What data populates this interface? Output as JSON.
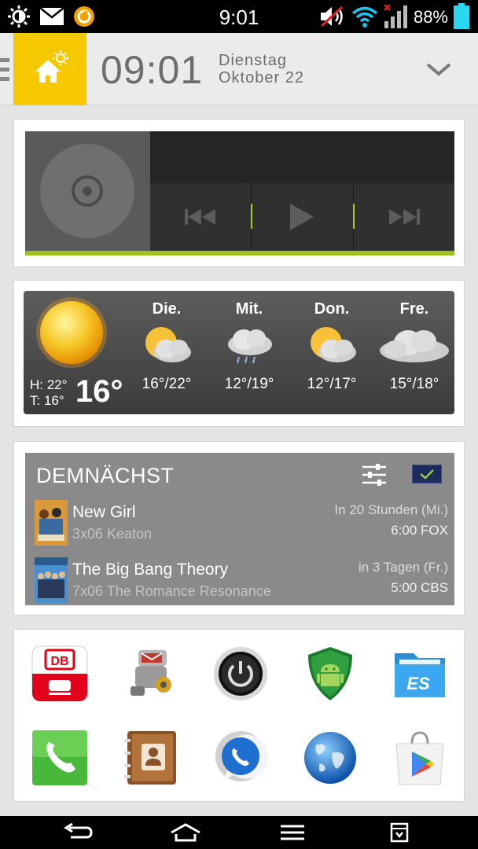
{
  "status_bar": {
    "time": "9:01",
    "battery": "88%",
    "icons": [
      "brightness-icon",
      "mail-icon",
      "sync-app-icon",
      "muted-speaker-icon",
      "wifi-icon",
      "signal-icon",
      "battery-icon"
    ]
  },
  "header": {
    "time": "09:01",
    "weekday": "Dienstag",
    "month_day": "Oktober 22"
  },
  "weather": {
    "high": "H: 22°",
    "low": "T: 16°",
    "current": "16°",
    "forecast": [
      {
        "day": "Die.",
        "temps": "16°/22°",
        "icon": "partly-cloudy-icon"
      },
      {
        "day": "Mit.",
        "temps": "12°/19°",
        "icon": "cloud-rain-icon"
      },
      {
        "day": "Don.",
        "temps": "12°/17°",
        "icon": "partly-cloudy-icon"
      },
      {
        "day": "Fre.",
        "temps": "15°/18°",
        "icon": "cloudy-icon"
      }
    ]
  },
  "upcoming": {
    "title": "DEMNÄCHST",
    "shows": [
      {
        "name": "New Girl",
        "episode": "3x06 Keaton",
        "when": "In 20 Stunden (Mi.)",
        "channel": "6:00 FOX"
      },
      {
        "name": "The Big Bang Theory",
        "episode": "7x06 The Romance Resonance",
        "when": "in 3 Tagen (Fr.)",
        "channel": "5:00 CBS"
      }
    ]
  },
  "apps": [
    {
      "label": "DB",
      "icon": "db-navigator-icon"
    },
    {
      "label": "",
      "icon": "mail-robot-icon"
    },
    {
      "label": "",
      "icon": "power-icon"
    },
    {
      "label": "",
      "icon": "android-shield-icon"
    },
    {
      "label": "ES",
      "icon": "es-file-explorer-icon"
    },
    {
      "label": "",
      "icon": "phone-icon"
    },
    {
      "label": "",
      "icon": "contacts-icon"
    },
    {
      "label": "",
      "icon": "whatsapp-plus-icon"
    },
    {
      "label": "",
      "icon": "globe-browser-icon"
    },
    {
      "label": "",
      "icon": "play-store-icon"
    }
  ],
  "colors": {
    "accent_yellow": "#f6c800",
    "music_green": "#9cc21d",
    "widget_gray": "#8a8a8a"
  }
}
